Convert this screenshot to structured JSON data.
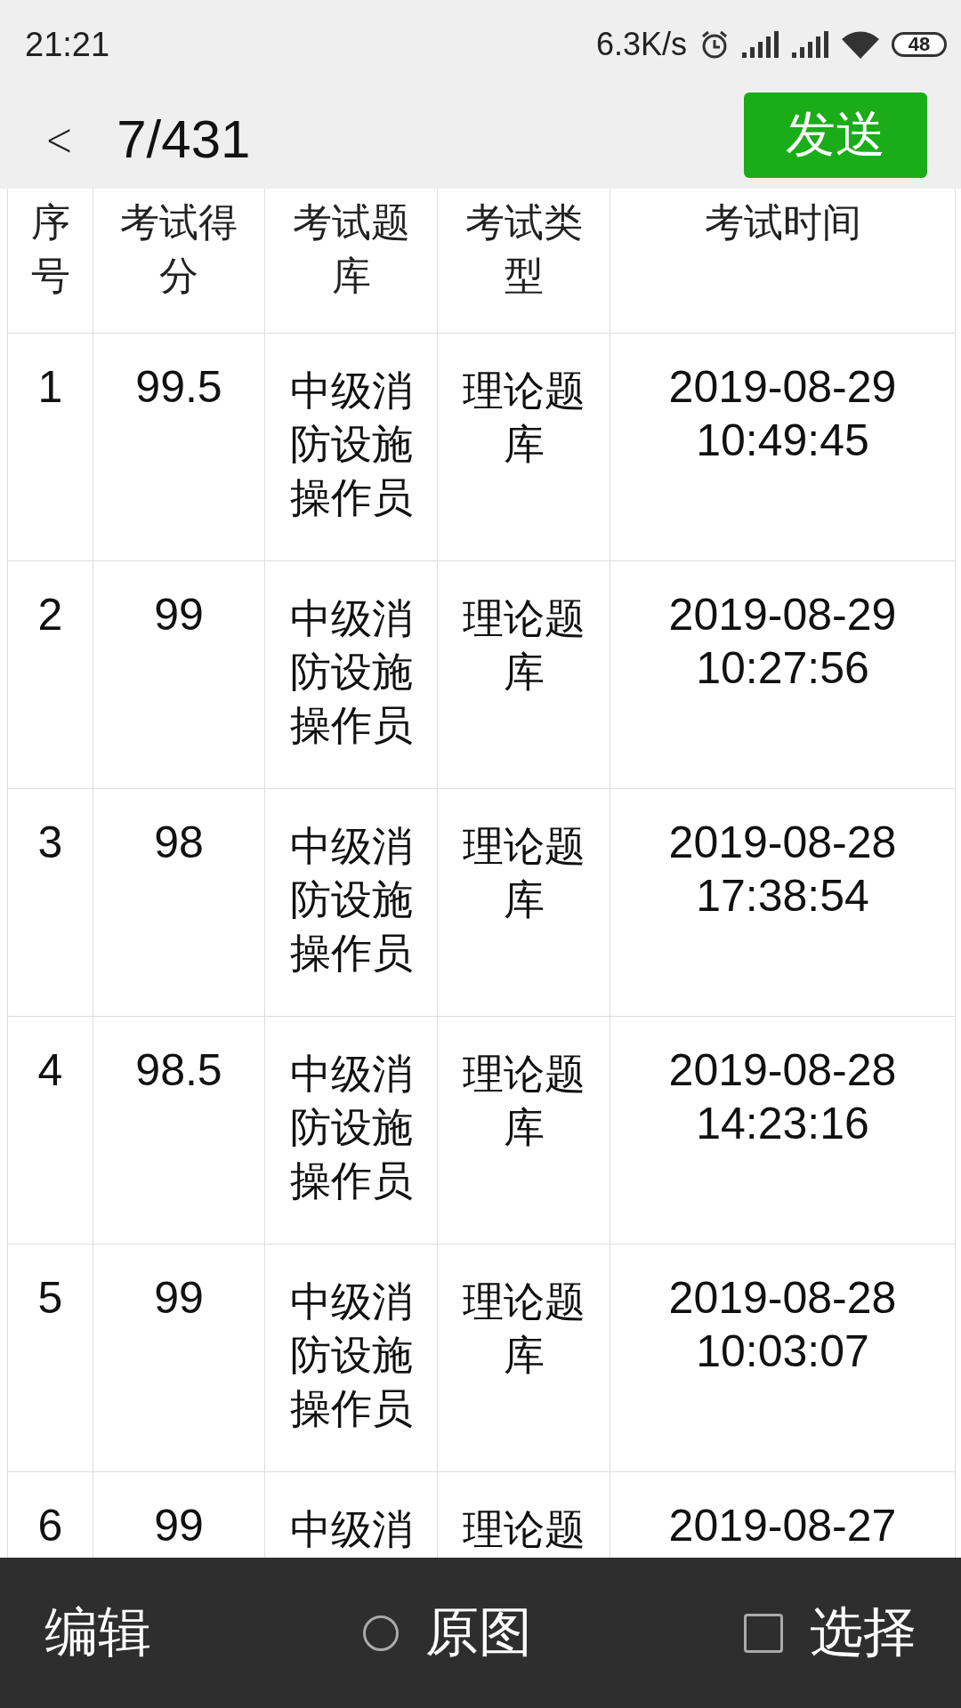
{
  "status_bar": {
    "time": "21:21",
    "speed": "6.3K/s",
    "battery": "48"
  },
  "header": {
    "back": "<",
    "counter": "7/431",
    "send_button": "发送"
  },
  "table": {
    "columns": [
      "序号",
      "考试得分",
      "考试题库",
      "考试类型",
      "考试时间"
    ],
    "rows": [
      [
        "1",
        "99.5",
        "中级消防设施操作员",
        "理论题库",
        "2019-08-29 10:49:45"
      ],
      [
        "2",
        "99",
        "中级消防设施操作员",
        "理论题库",
        "2019-08-29 10:27:56"
      ],
      [
        "3",
        "98",
        "中级消防设施操作员",
        "理论题库",
        "2019-08-28 17:38:54"
      ],
      [
        "4",
        "98.5",
        "中级消防设施操作员",
        "理论题库",
        "2019-08-28 14:23:16"
      ],
      [
        "5",
        "99",
        "中级消防设施操作员",
        "理论题库",
        "2019-08-28 10:03:07"
      ],
      [
        "6",
        "99",
        "中级消",
        "理论题",
        "2019-08-27"
      ]
    ]
  },
  "bottom_bar": {
    "edit": "编辑",
    "original": {
      "label": "原图",
      "checked": false
    },
    "select": {
      "label": "选择",
      "checked": false
    }
  }
}
